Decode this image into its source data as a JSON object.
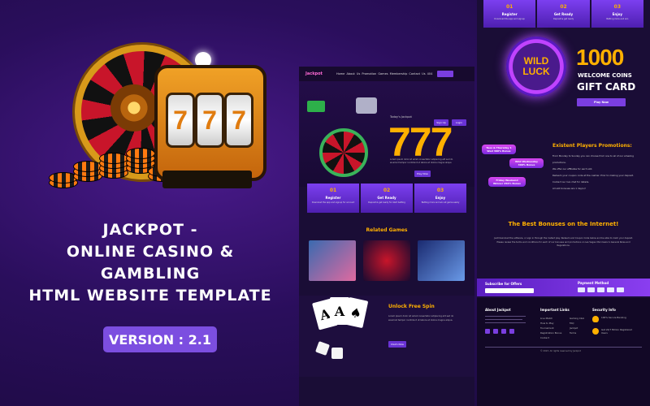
{
  "hero": {
    "title_line1": "JACKPOT -",
    "title_line2": "ONLINE CASINO & GAMBLING",
    "title_line3": "HTML  WEBSITE TEMPLATE",
    "version": "VERSION : 2.1",
    "slot_reels": [
      "7",
      "7",
      "7"
    ]
  },
  "mid_preview": {
    "logo": "Jackpot",
    "nav_links": "Home   About Us   Promotion   Games   Membership   Contact Us   404",
    "todays_jackpot": "Today's Jackpot",
    "jackpot_digits": "777",
    "signup": "Sign Up",
    "login": "Login",
    "play_now": "Play Now",
    "hero_text": "Lorem ipsum dolor sit amet consectetur adipiscing elit sed do eiusmod tempor incididunt ut labore et dolore magna aliqua",
    "steps": [
      {
        "num": "01",
        "title": "Register",
        "desc": "Download the app and signup for account"
      },
      {
        "num": "02",
        "title": "Get Ready",
        "desc": "Deposit & get ready for start betting"
      },
      {
        "num": "03",
        "title": "Enjoy",
        "desc": "Betting more and win all game easily"
      }
    ],
    "related_title": "Related Games",
    "spin_title": "Unlock Free Spin",
    "spin_text": "Lorem ipsum dolor sit amet consectetur adipiscing elit sed do eiusmod tempor incididunt ut labore et dolore magna aliqua.",
    "spin_button": "Claim Now",
    "cards": [
      "A",
      "A",
      "♠"
    ]
  },
  "right_preview": {
    "steps": [
      {
        "num": "01",
        "title": "Register",
        "desc": "Download the app and signup"
      },
      {
        "num": "02",
        "title": "Get Ready",
        "desc": "Deposit & get ready"
      },
      {
        "num": "03",
        "title": "Enjoy",
        "desc": "Betting more and win"
      }
    ],
    "wild_line1": "WILD",
    "wild_line2": "LUCK",
    "coins_number": "1000",
    "welcome_coins": "WELCOME COINS",
    "gift_card": "GIFT CARD",
    "play_now": "Play Now",
    "badges": [
      "Tues & Thursday 1 Wed 300% Bonus",
      "Wild Wednesday 300% Bonus",
      "Friday Weekend Winner 250% Bonus"
    ],
    "promo_title": "Existent Players Promotions:",
    "promo_items": [
      "From Monday to Sunday you can choose from one to all of our amazing promotions.",
      "We offer our affiliates for each slot.",
      "Redeem your coupon code at the cashier. Prior to making your deposit.",
      "Contact our live chat for details.",
      "All slot bonuses are 1 day(s)!"
    ],
    "bonus_title": "The Best Bonuses on the Internet!",
    "bonus_text": "Just Download the software, or sign in through the Instant play. Redeem and Coupon Code below and be able to claim your deposit. Please review the terms and conditions for each of our bonuses and promotions on Las Vegas USA Casino's General Rules and Regulations.",
    "subscribe": "Subscribe for Offers",
    "payment": "Payment Method",
    "footer": {
      "about": "About Jackpot",
      "links": "Important Links",
      "security": "Security Info",
      "link_items": [
        "Live Match",
        "How to Play",
        "Tournament",
        "Registration Bonus",
        "Contact"
      ],
      "link_items2": [
        "Gaming Club",
        "FAQ",
        "Jackpot",
        "Terms"
      ],
      "security_items": [
        "100% Secure Banking",
        "Get 24/7 Million Registered Users"
      ],
      "copyright": "© 2023. All rights reserved by Jackpot"
    }
  },
  "colors": {
    "accent": "#7c4ee0",
    "gold": "#ffb000",
    "bg": "#2a0e5c"
  }
}
